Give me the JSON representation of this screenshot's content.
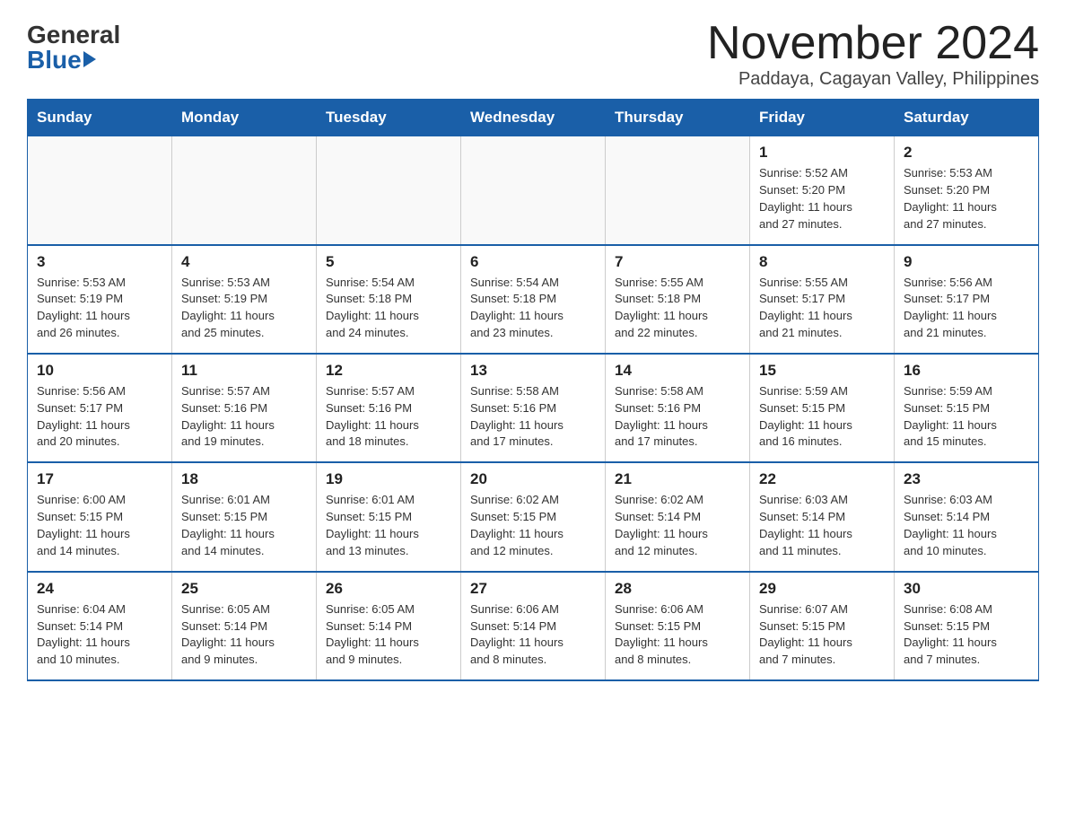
{
  "logo": {
    "general": "General",
    "blue": "Blue"
  },
  "title": {
    "month_year": "November 2024",
    "location": "Paddaya, Cagayan Valley, Philippines"
  },
  "weekdays": [
    "Sunday",
    "Monday",
    "Tuesday",
    "Wednesday",
    "Thursday",
    "Friday",
    "Saturday"
  ],
  "weeks": [
    [
      {
        "day": "",
        "info": ""
      },
      {
        "day": "",
        "info": ""
      },
      {
        "day": "",
        "info": ""
      },
      {
        "day": "",
        "info": ""
      },
      {
        "day": "",
        "info": ""
      },
      {
        "day": "1",
        "info": "Sunrise: 5:52 AM\nSunset: 5:20 PM\nDaylight: 11 hours\nand 27 minutes."
      },
      {
        "day": "2",
        "info": "Sunrise: 5:53 AM\nSunset: 5:20 PM\nDaylight: 11 hours\nand 27 minutes."
      }
    ],
    [
      {
        "day": "3",
        "info": "Sunrise: 5:53 AM\nSunset: 5:19 PM\nDaylight: 11 hours\nand 26 minutes."
      },
      {
        "day": "4",
        "info": "Sunrise: 5:53 AM\nSunset: 5:19 PM\nDaylight: 11 hours\nand 25 minutes."
      },
      {
        "day": "5",
        "info": "Sunrise: 5:54 AM\nSunset: 5:18 PM\nDaylight: 11 hours\nand 24 minutes."
      },
      {
        "day": "6",
        "info": "Sunrise: 5:54 AM\nSunset: 5:18 PM\nDaylight: 11 hours\nand 23 minutes."
      },
      {
        "day": "7",
        "info": "Sunrise: 5:55 AM\nSunset: 5:18 PM\nDaylight: 11 hours\nand 22 minutes."
      },
      {
        "day": "8",
        "info": "Sunrise: 5:55 AM\nSunset: 5:17 PM\nDaylight: 11 hours\nand 21 minutes."
      },
      {
        "day": "9",
        "info": "Sunrise: 5:56 AM\nSunset: 5:17 PM\nDaylight: 11 hours\nand 21 minutes."
      }
    ],
    [
      {
        "day": "10",
        "info": "Sunrise: 5:56 AM\nSunset: 5:17 PM\nDaylight: 11 hours\nand 20 minutes."
      },
      {
        "day": "11",
        "info": "Sunrise: 5:57 AM\nSunset: 5:16 PM\nDaylight: 11 hours\nand 19 minutes."
      },
      {
        "day": "12",
        "info": "Sunrise: 5:57 AM\nSunset: 5:16 PM\nDaylight: 11 hours\nand 18 minutes."
      },
      {
        "day": "13",
        "info": "Sunrise: 5:58 AM\nSunset: 5:16 PM\nDaylight: 11 hours\nand 17 minutes."
      },
      {
        "day": "14",
        "info": "Sunrise: 5:58 AM\nSunset: 5:16 PM\nDaylight: 11 hours\nand 17 minutes."
      },
      {
        "day": "15",
        "info": "Sunrise: 5:59 AM\nSunset: 5:15 PM\nDaylight: 11 hours\nand 16 minutes."
      },
      {
        "day": "16",
        "info": "Sunrise: 5:59 AM\nSunset: 5:15 PM\nDaylight: 11 hours\nand 15 minutes."
      }
    ],
    [
      {
        "day": "17",
        "info": "Sunrise: 6:00 AM\nSunset: 5:15 PM\nDaylight: 11 hours\nand 14 minutes."
      },
      {
        "day": "18",
        "info": "Sunrise: 6:01 AM\nSunset: 5:15 PM\nDaylight: 11 hours\nand 14 minutes."
      },
      {
        "day": "19",
        "info": "Sunrise: 6:01 AM\nSunset: 5:15 PM\nDaylight: 11 hours\nand 13 minutes."
      },
      {
        "day": "20",
        "info": "Sunrise: 6:02 AM\nSunset: 5:15 PM\nDaylight: 11 hours\nand 12 minutes."
      },
      {
        "day": "21",
        "info": "Sunrise: 6:02 AM\nSunset: 5:14 PM\nDaylight: 11 hours\nand 12 minutes."
      },
      {
        "day": "22",
        "info": "Sunrise: 6:03 AM\nSunset: 5:14 PM\nDaylight: 11 hours\nand 11 minutes."
      },
      {
        "day": "23",
        "info": "Sunrise: 6:03 AM\nSunset: 5:14 PM\nDaylight: 11 hours\nand 10 minutes."
      }
    ],
    [
      {
        "day": "24",
        "info": "Sunrise: 6:04 AM\nSunset: 5:14 PM\nDaylight: 11 hours\nand 10 minutes."
      },
      {
        "day": "25",
        "info": "Sunrise: 6:05 AM\nSunset: 5:14 PM\nDaylight: 11 hours\nand 9 minutes."
      },
      {
        "day": "26",
        "info": "Sunrise: 6:05 AM\nSunset: 5:14 PM\nDaylight: 11 hours\nand 9 minutes."
      },
      {
        "day": "27",
        "info": "Sunrise: 6:06 AM\nSunset: 5:14 PM\nDaylight: 11 hours\nand 8 minutes."
      },
      {
        "day": "28",
        "info": "Sunrise: 6:06 AM\nSunset: 5:15 PM\nDaylight: 11 hours\nand 8 minutes."
      },
      {
        "day": "29",
        "info": "Sunrise: 6:07 AM\nSunset: 5:15 PM\nDaylight: 11 hours\nand 7 minutes."
      },
      {
        "day": "30",
        "info": "Sunrise: 6:08 AM\nSunset: 5:15 PM\nDaylight: 11 hours\nand 7 minutes."
      }
    ]
  ]
}
